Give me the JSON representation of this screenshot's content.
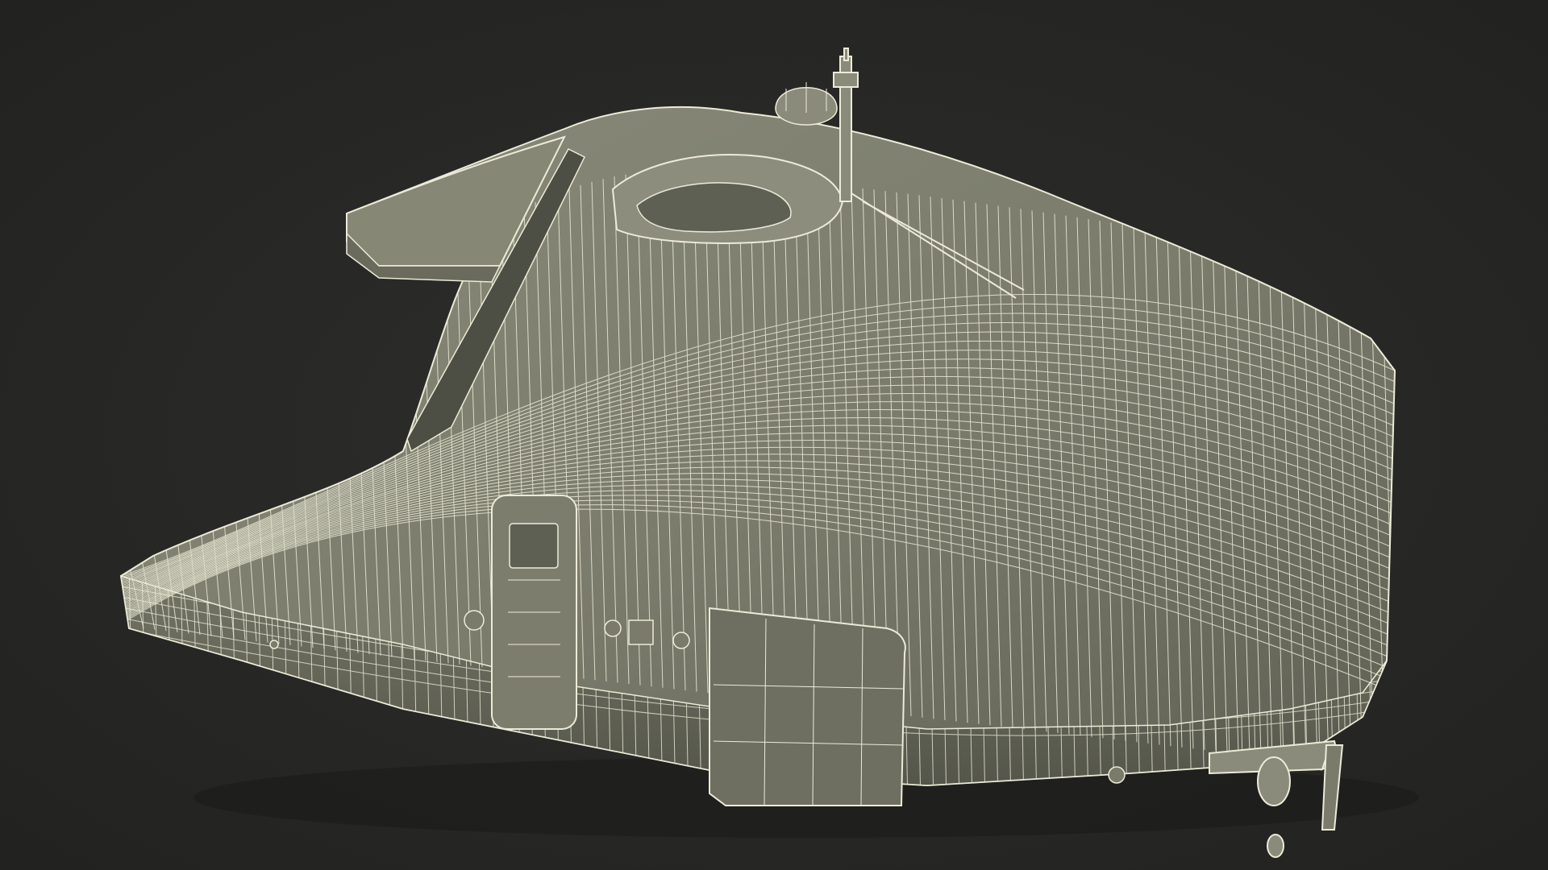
{
  "scene": {
    "subject": "wireframe-boat-model",
    "colors": {
      "background": "#262624",
      "background_vignette": "#2e2e2c",
      "surface": "#7a7b6b",
      "surface_light": "#8a8b7a",
      "surface_dark": "#5f6054",
      "wire": "#ecebd8",
      "shadow": "#1a1a19"
    }
  }
}
